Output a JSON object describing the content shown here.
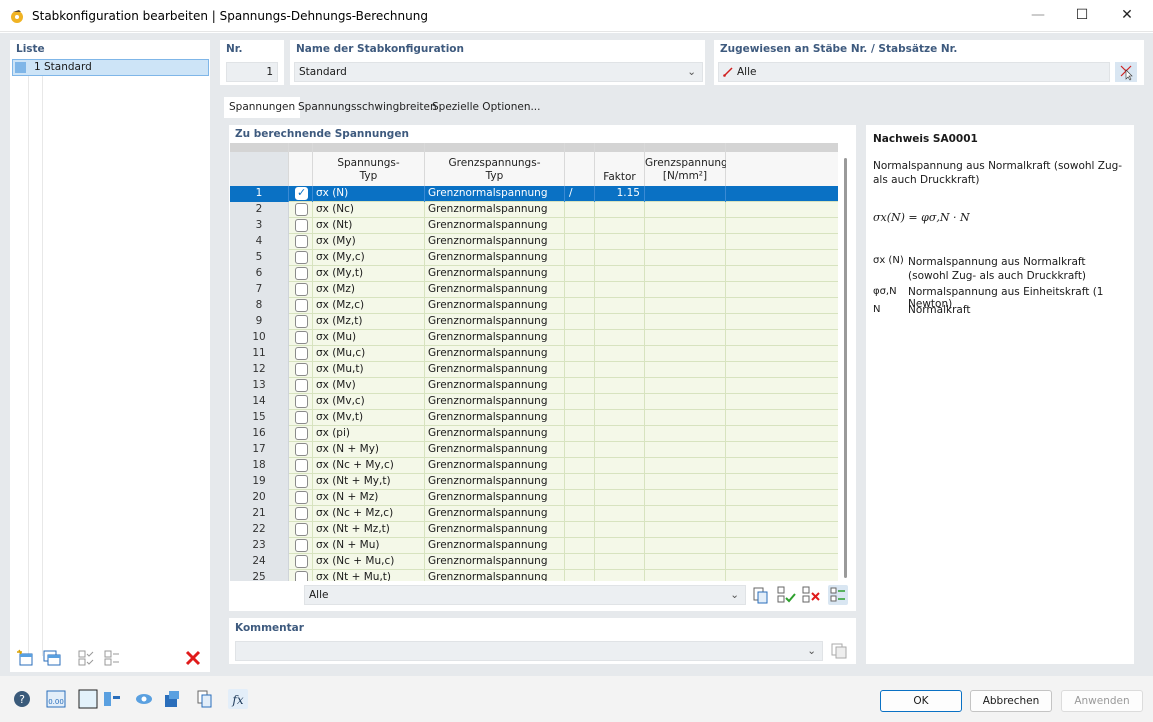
{
  "window": {
    "title": "Stabkonfiguration bearbeiten | Spannungs-Dehnungs-Berechnung",
    "minimize": "—",
    "maximize": "☐",
    "close": "✕"
  },
  "list": {
    "label": "Liste",
    "items": [
      {
        "text": "1 Standard"
      }
    ]
  },
  "nr": {
    "label": "Nr.",
    "value": "1"
  },
  "name": {
    "label": "Name der Stabkonfiguration",
    "value": "Standard"
  },
  "assigned": {
    "label": "Zugewiesen an Stäbe Nr. / Stabsätze Nr.",
    "value": "Alle"
  },
  "tabs": [
    {
      "label": "Spannungen"
    },
    {
      "label": "Spannungsschwingbreiten"
    },
    {
      "label": "Spezielle Optionen..."
    }
  ],
  "stress_section": {
    "title": "Zu berechnende Spannungen"
  },
  "table": {
    "headers": {
      "typ1": "Spannungs-",
      "typ2": "Typ",
      "gtyp1": "Grenzspannungs-",
      "gtyp2": "Typ",
      "faktor": "Faktor",
      "grenz1": "Grenzspannung",
      "grenz2": "[N/mm²]"
    },
    "rows": [
      {
        "num": "1",
        "stress": "σx (N)",
        "limit": "Grenznormalspannung",
        "slash": "/",
        "factor": "1.15",
        "checked": true
      },
      {
        "num": "2",
        "stress": "σx (Nc)",
        "limit": "Grenznormalspannung"
      },
      {
        "num": "3",
        "stress": "σx (Nt)",
        "limit": "Grenznormalspannung"
      },
      {
        "num": "4",
        "stress": "σx (My)",
        "limit": "Grenznormalspannung"
      },
      {
        "num": "5",
        "stress": "σx (My,c)",
        "limit": "Grenznormalspannung"
      },
      {
        "num": "6",
        "stress": "σx (My,t)",
        "limit": "Grenznormalspannung"
      },
      {
        "num": "7",
        "stress": "σx (Mz)",
        "limit": "Grenznormalspannung"
      },
      {
        "num": "8",
        "stress": "σx (Mz,c)",
        "limit": "Grenznormalspannung"
      },
      {
        "num": "9",
        "stress": "σx (Mz,t)",
        "limit": "Grenznormalspannung"
      },
      {
        "num": "10",
        "stress": "σx (Mu)",
        "limit": "Grenznormalspannung"
      },
      {
        "num": "11",
        "stress": "σx (Mu,c)",
        "limit": "Grenznormalspannung"
      },
      {
        "num": "12",
        "stress": "σx (Mu,t)",
        "limit": "Grenznormalspannung"
      },
      {
        "num": "13",
        "stress": "σx (Mv)",
        "limit": "Grenznormalspannung"
      },
      {
        "num": "14",
        "stress": "σx (Mv,c)",
        "limit": "Grenznormalspannung"
      },
      {
        "num": "15",
        "stress": "σx (Mv,t)",
        "limit": "Grenznormalspannung"
      },
      {
        "num": "16",
        "stress": "σx (pi)",
        "limit": "Grenznormalspannung"
      },
      {
        "num": "17",
        "stress": "σx (N + My)",
        "limit": "Grenznormalspannung"
      },
      {
        "num": "18",
        "stress": "σx (Nc + My,c)",
        "limit": "Grenznormalspannung"
      },
      {
        "num": "19",
        "stress": "σx (Nt + My,t)",
        "limit": "Grenznormalspannung"
      },
      {
        "num": "20",
        "stress": "σx (N + Mz)",
        "limit": "Grenznormalspannung"
      },
      {
        "num": "21",
        "stress": "σx (Nc + Mz,c)",
        "limit": "Grenznormalspannung"
      },
      {
        "num": "22",
        "stress": "σx (Nt + Mz,t)",
        "limit": "Grenznormalspannung"
      },
      {
        "num": "23",
        "stress": "σx (N + Mu)",
        "limit": "Grenznormalspannung"
      },
      {
        "num": "24",
        "stress": "σx (Nc + Mu,c)",
        "limit": "Grenznormalspannung"
      },
      {
        "num": "25",
        "stress": "σx (Nt + Mu,t)",
        "limit": "Grenznormalspannung"
      }
    ]
  },
  "filter": {
    "value": "Alle"
  },
  "comment": {
    "label": "Kommentar",
    "value": ""
  },
  "info": {
    "title": "Nachweis SA0001",
    "description": "Normalspannung aus Normalkraft (sowohl Zug- als auch Druckkraft)",
    "formula": "σx(N) = φσ,N · N",
    "legend": [
      {
        "sym": "σx (N)",
        "text": "Normalspannung aus Normalkraft (sowohl Zug- als auch Druckkraft)"
      },
      {
        "sym": "φσ,N",
        "text": "Normalspannung aus Einheitskraft (1 Newton)"
      },
      {
        "sym": "N",
        "text": "Normalkraft"
      }
    ]
  },
  "buttons": {
    "ok": "OK",
    "cancel": "Abbrechen",
    "apply": "Anwenden"
  },
  "colors": {
    "selection": "#0a71c4",
    "header_label": "#3e5a7e",
    "row_bg": "#f4f8e8",
    "delete_red": "#e01b1b"
  },
  "bottom_icons": [
    "help-icon",
    "decimal-icon",
    "color-icon",
    "member-icon",
    "view-icon",
    "render-icon",
    "copy-icon",
    "formula-icon"
  ]
}
